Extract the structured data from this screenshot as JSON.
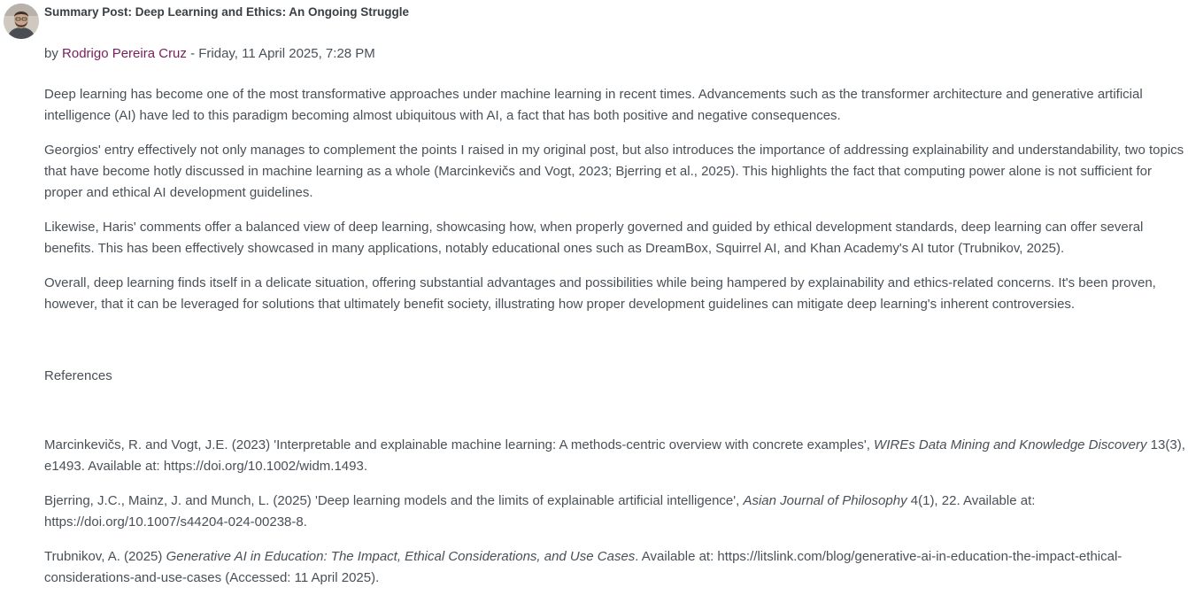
{
  "post": {
    "title": "Summary Post: Deep Learning and Ethics: An Ongoing Struggle",
    "by_prefix": "by ",
    "author": "Rodrigo Pereira Cruz",
    "date_sep": " - ",
    "date": "Friday, 11 April 2025, 7:28 PM"
  },
  "paragraphs": [
    "Deep learning has become one of the most transformative approaches under machine learning in recent times. Advancements such as the transformer architecture and generative artificial intelligence (AI) have led to this paradigm becoming almost ubiquitous with AI, a fact that has both positive and negative consequences.",
    "Georgios' entry effectively not only manages to complement the points I raised in my original post, but also introduces the importance of addressing explainability and understandability, two topics that have become hotly discussed in machine learning as a whole (Marcinkevičs and Vogt, 2023; Bjerring et al., 2025). This highlights the fact that computing power alone is not sufficient for proper and ethical AI development guidelines.",
    "Likewise, Haris' comments offer a balanced view of deep learning, showcasing how, when properly governed and guided by ethical development standards, deep learning can offer several benefits. This has been effectively showcased in many applications, notably educational ones such as DreamBox, Squirrel AI, and Khan Academy's AI tutor (Trubnikov, 2025).",
    "Overall, deep learning finds itself in a delicate situation, offering substantial advantages and possibilities while being hampered by explainability and ethics-related concerns. It's been proven, however, that it can be leveraged for solutions that ultimately benefit society, illustrating how proper development guidelines can mitigate deep learning's inherent controversies."
  ],
  "references_heading": "References",
  "references": [
    {
      "before": "Marcinkevičs, R. and Vogt, J.E. (2023) 'Interpretable and explainable machine learning: A methods-centric overview with concrete examples', ",
      "italic": "WIREs Data Mining and Knowledge Discovery",
      "after": " 13(3), e1493. Available at: https://doi.org/10.1002/widm.1493."
    },
    {
      "before": "Bjerring, J.C., Mainz, J. and Munch, L. (2025) 'Deep learning models and the limits of explainable artificial intelligence', ",
      "italic": "Asian Journal of Philosophy",
      "after": " 4(1), 22. Available at: https://doi.org/10.1007/s44204-024-00238-8."
    },
    {
      "before": "Trubnikov, A. (2025) ",
      "italic": "Generative AI in Education: The Impact, Ethical Considerations, and Use Cases",
      "after": ". Available at: https://litslink.com/blog/generative-ai-in-education-the-impact-ethical-considerations-and-use-cases (Accessed: 11 April 2025)."
    }
  ]
}
